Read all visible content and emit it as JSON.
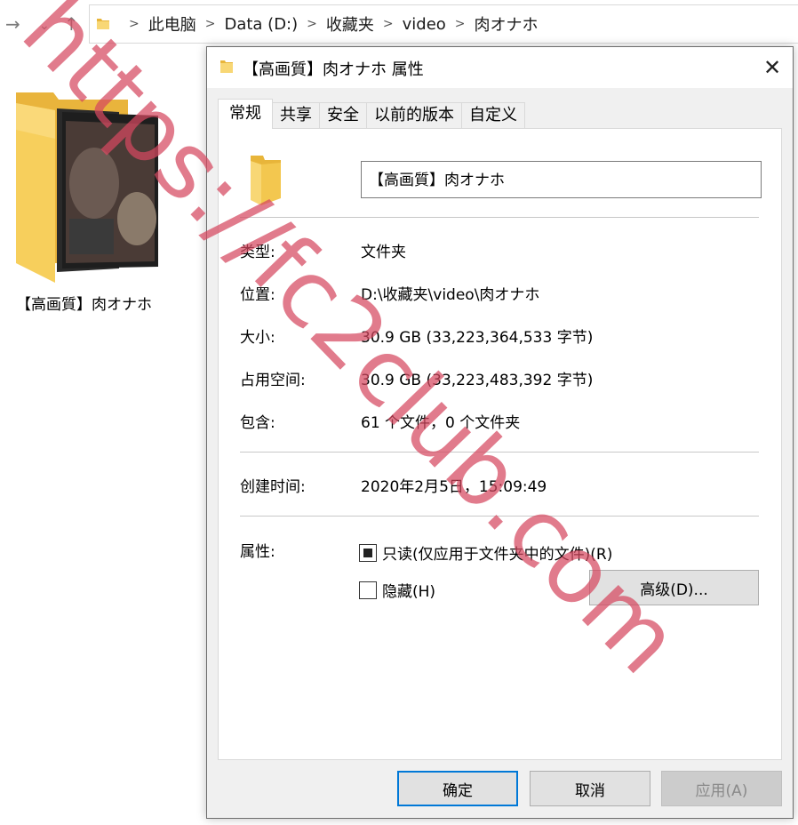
{
  "explorer": {
    "breadcrumbs": [
      "此电脑",
      "Data (D:)",
      "收藏夹",
      "video",
      "肉オナホ"
    ],
    "folder_caption": "【高画質】肉オナホ"
  },
  "dialog": {
    "title": "【高画質】肉オナホ 属性",
    "tabs": [
      "常规",
      "共享",
      "安全",
      "以前的版本",
      "自定义"
    ],
    "name_value": "【高画質】肉オナホ",
    "props": {
      "type_label": "类型:",
      "type_value": "文件夹",
      "location_label": "位置:",
      "location_value": "D:\\收藏夹\\video\\肉オナホ",
      "size_label": "大小:",
      "size_value": "30.9 GB (33,223,364,533 字节)",
      "disk_label": "占用空间:",
      "disk_value": "30.9 GB (33,223,483,392 字节)",
      "contains_label": "包含:",
      "contains_value": "61 个文件，0 个文件夹",
      "created_label": "创建时间:",
      "created_value": "2020年2月5日，15:09:49",
      "attributes_label": "属性:"
    },
    "attributes": {
      "readonly_label": "只读(仅应用于文件夹中的文件)(R)",
      "readonly_state": "indeterminate",
      "hidden_label": "隐藏(H)",
      "hidden_checked": false,
      "advanced_button": "高级(D)..."
    },
    "buttons": {
      "ok": "确定",
      "cancel": "取消",
      "apply": "应用(A)"
    }
  },
  "watermark": {
    "text": "https://fc2club.com",
    "color": "#d6485f"
  },
  "colors": {
    "folder_yellow": "#f5c84c",
    "accent": "#0078d7"
  }
}
